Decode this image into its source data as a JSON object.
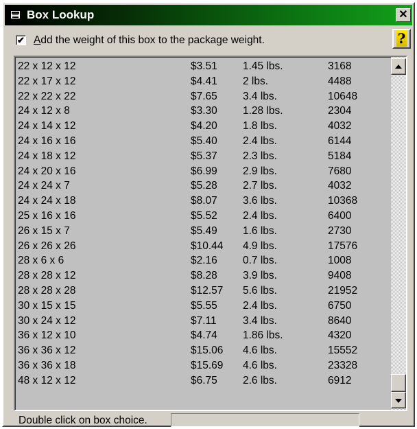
{
  "window": {
    "title": "Box Lookup",
    "close_label": "✕"
  },
  "options": {
    "checkbox_checked": true,
    "checkbox_mark": "✔",
    "checkbox_label_accel": "A",
    "checkbox_label_rest": "dd the weight of this box to the package weight.",
    "help_label": "?"
  },
  "list": {
    "rows": [
      {
        "size": "22 x 12 x 12",
        "price": "$3.51",
        "weight": "1.45 lbs.",
        "volume": "3168"
      },
      {
        "size": "22 x 17 x 12",
        "price": "$4.41",
        "weight": "2 lbs.",
        "volume": "4488"
      },
      {
        "size": "22 x 22 x 22",
        "price": "$7.65",
        "weight": "3.4 lbs.",
        "volume": "10648"
      },
      {
        "size": "24 x 12 x 8",
        "price": "$3.30",
        "weight": "1.28 lbs.",
        "volume": "2304"
      },
      {
        "size": "24 x 14 x 12",
        "price": "$4.20",
        "weight": "1.8 lbs.",
        "volume": "4032"
      },
      {
        "size": "24 x 16 x 16",
        "price": "$5.40",
        "weight": "2.4 lbs.",
        "volume": "6144"
      },
      {
        "size": "24 x 18 x 12",
        "price": "$5.37",
        "weight": "2.3 lbs.",
        "volume": "5184"
      },
      {
        "size": "24 x 20 x 16",
        "price": "$6.99",
        "weight": "2.9 lbs.",
        "volume": "7680"
      },
      {
        "size": "24 x 24 x 7",
        "price": "$5.28",
        "weight": "2.7 lbs.",
        "volume": "4032"
      },
      {
        "size": "24 x 24 x 18",
        "price": "$8.07",
        "weight": "3.6 lbs.",
        "volume": "10368"
      },
      {
        "size": "25 x 16 x 16",
        "price": "$5.52",
        "weight": "2.4 lbs.",
        "volume": "6400"
      },
      {
        "size": "26 x 15 x 7",
        "price": "$5.49",
        "weight": "1.6 lbs.",
        "volume": "2730"
      },
      {
        "size": "26 x 26 x 26",
        "price": "$10.44",
        "weight": "4.9 lbs.",
        "volume": "17576"
      },
      {
        "size": "28 x 6 x 6",
        "price": "$2.16",
        "weight": "0.7 lbs.",
        "volume": "1008"
      },
      {
        "size": "28 x 28 x 12",
        "price": "$8.28",
        "weight": "3.9 lbs.",
        "volume": "9408"
      },
      {
        "size": "28 x 28 x 28",
        "price": "$12.57",
        "weight": "5.6 lbs.",
        "volume": "21952"
      },
      {
        "size": "30 x 15 x 15",
        "price": "$5.55",
        "weight": "2.4 lbs.",
        "volume": "6750"
      },
      {
        "size": "30 x 24 x 12",
        "price": "$7.11",
        "weight": "3.4 lbs.",
        "volume": "8640"
      },
      {
        "size": "36 x 12 x 10",
        "price": "$4.74",
        "weight": "1.86 lbs.",
        "volume": "4320"
      },
      {
        "size": "36 x 36 x 12",
        "price": "$15.06",
        "weight": "4.6 lbs.",
        "volume": "15552"
      },
      {
        "size": "36 x 36 x 18",
        "price": "$15.69",
        "weight": "4.6 lbs.",
        "volume": "23328"
      },
      {
        "size": "48 x 12 x 12",
        "price": "$6.75",
        "weight": "2.6 lbs.",
        "volume": "6912"
      }
    ]
  },
  "status": {
    "label": "Double click on box choice.",
    "field_value": ""
  }
}
